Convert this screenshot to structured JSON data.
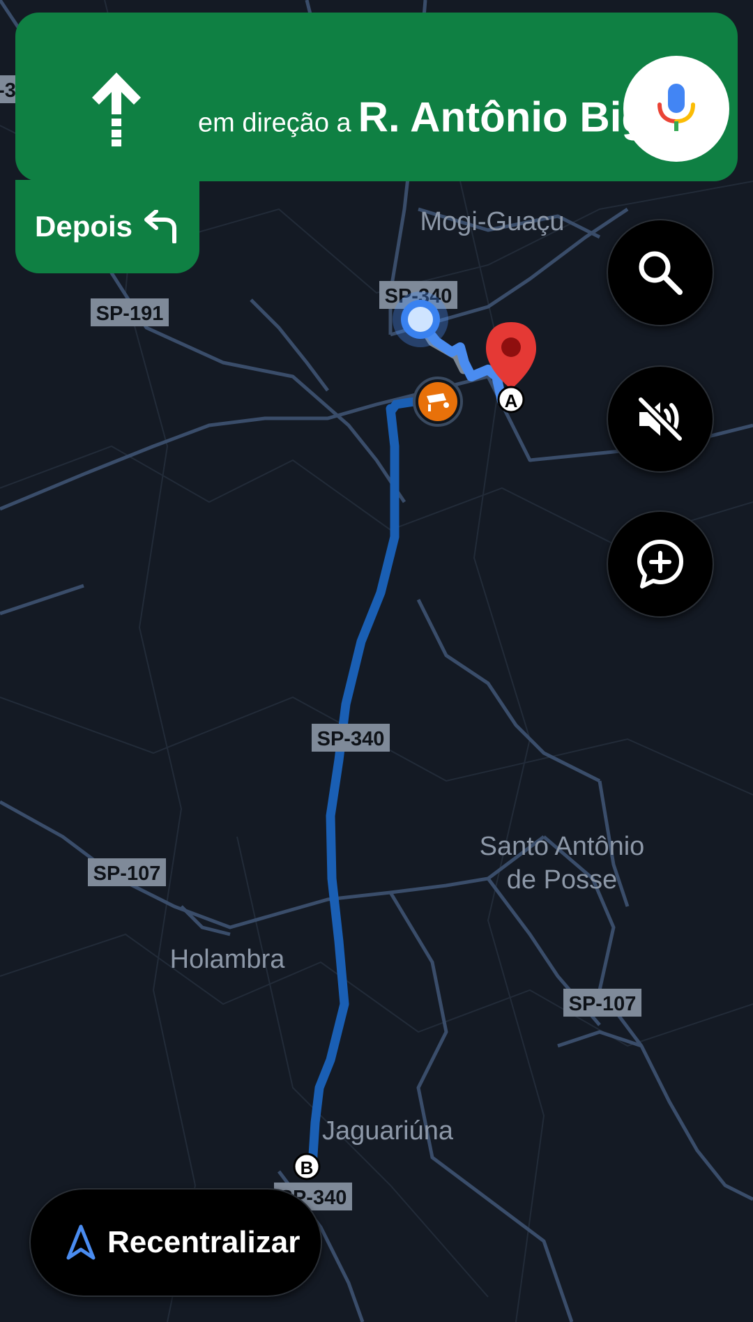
{
  "navigation": {
    "prefix": "em direção a",
    "street": "R. Antônio Bigeli",
    "maneuver_icon": "straight-arrow-icon"
  },
  "then_card": {
    "label": "Depois",
    "icon": "turn-left-icon"
  },
  "buttons": {
    "voice": "mic-icon",
    "search": "search-icon",
    "mute": "sound-off-icon",
    "report": "add-report-icon",
    "recenter_label": "Recentralizar"
  },
  "map": {
    "places": {
      "mogi_guacu": "Mogi-Guaçu",
      "santo_antonio_line1": "Santo Antônio",
      "santo_antonio_line2": "de Posse",
      "holambra": "Holambra",
      "jaguariuna": "Jaguariúna"
    },
    "road_labels": {
      "sp340_top": "SP-340",
      "sp191": "SP-191",
      "sp340_mid": "SP-340",
      "sp107_left": "SP-107",
      "sp107_right": "SP-107",
      "sp340_bottom": "SP-340",
      "edge_left": "-3"
    },
    "markers": {
      "waypoint_a": "A",
      "waypoint_b": "B"
    }
  },
  "colors": {
    "map_background": "#141a24",
    "roads": "#3a4d6a",
    "route": "#1a5fb4",
    "route_active": "#4a8cf0",
    "nav_green": "#0f8043",
    "pin_red": "#e53935",
    "camera_orange": "#e8710a"
  }
}
